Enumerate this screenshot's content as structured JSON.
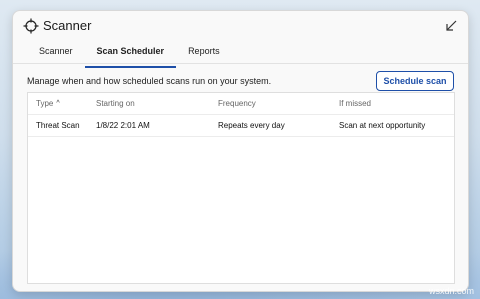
{
  "window": {
    "title": "Scanner",
    "title_icon": "crosshair-icon",
    "restore_icon": "restore-icon"
  },
  "tabs": [
    {
      "label": "Scanner",
      "active": false
    },
    {
      "label": "Scan Scheduler",
      "active": true
    },
    {
      "label": "Reports",
      "active": false
    }
  ],
  "main": {
    "description": "Manage when and how scheduled scans run on your system.",
    "schedule_button": "Schedule scan"
  },
  "table": {
    "columns": [
      "Type",
      "Starting on",
      "Frequency",
      "If missed"
    ],
    "sort_indicator": "^",
    "rows": [
      [
        "Threat Scan",
        "1/8/22 2:01 AM",
        "Repeats every day",
        "Scan at next opportunity"
      ]
    ]
  },
  "watermark": "wsxdn.com",
  "colors": {
    "accent": "#1e4fa8",
    "window_bg": "#f9f9f9"
  }
}
